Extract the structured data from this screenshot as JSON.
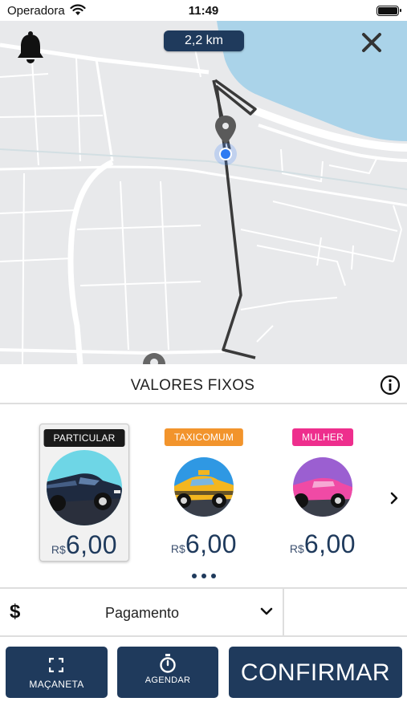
{
  "status_bar": {
    "carrier": "Operadora",
    "time": "11:49"
  },
  "map": {
    "distance": "2,2 km",
    "icons": [
      "bell-icon",
      "close-icon",
      "map-pin-icon",
      "current-location-icon"
    ]
  },
  "fixed_values": {
    "title": "VALORES FIXOS",
    "info_icon": "info-icon"
  },
  "cards": [
    {
      "badge": "PARTICULAR",
      "badge_color": "#1a1a1a",
      "currency": "R$",
      "price": "6,00",
      "selected": true
    },
    {
      "badge": "TAXICOMUM",
      "badge_color": "#f2942c",
      "currency": "R$",
      "price": "6,00",
      "selected": false
    },
    {
      "badge": "MULHER",
      "badge_color": "#ee2e8d",
      "currency": "R$",
      "price": "6,00",
      "selected": false
    }
  ],
  "payment": {
    "icon": "dollar-icon",
    "label": "Pagamento"
  },
  "buttons": {
    "handle": "MAÇANETA",
    "schedule": "AGENDAR",
    "confirm": "CONFIRMAR"
  },
  "colors": {
    "primary": "#1f3a5c",
    "water": "#aad3e9",
    "map_bg": "#e8e9eb"
  }
}
